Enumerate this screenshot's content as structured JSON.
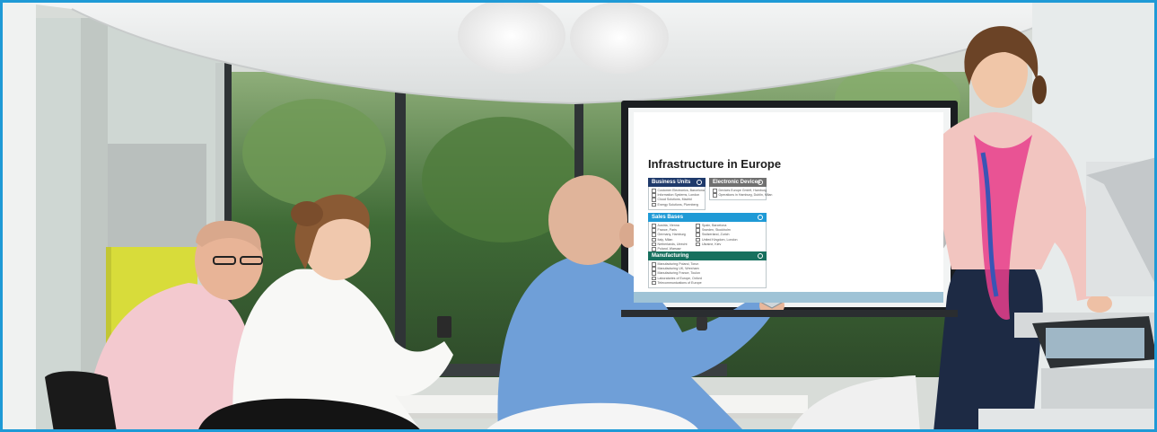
{
  "presentation": {
    "title": "Infrastructure in Europe",
    "sections": [
      {
        "heading": "Business Units",
        "color": "#1f3a6b",
        "items": [
          "Customer Electronics, Barcelona",
          "Information Systems, London",
          "Cloud Solutions, Madrid",
          "Energy Solutions, Plzenberg"
        ]
      },
      {
        "heading": "Electronic Devices",
        "color": "#707070",
        "items": [
          "Devices Europe GmbH, Hamburg",
          "Operations in Hamburg, Dublin, Milan"
        ]
      },
      {
        "heading": "Sales Bases",
        "color": "#1f9ad6",
        "items_left": [
          "Austria, Vienna",
          "France, Paris",
          "Germany, Hamburg",
          "Italy, Milan",
          "Netherlands, Utrecht",
          "Poland, Warsaw"
        ],
        "items_right": [
          "Spain, Barcelona",
          "Sweden, Stockholm",
          "Switzerland, Zurich",
          "United Kingdom, London",
          "Ukraine, Kiev"
        ]
      },
      {
        "heading": "Manufacturing",
        "color": "#17705e",
        "items": [
          "Manufacturing Poland, Torun",
          "Manufacturing UK, Wrexham",
          "Manufacturing France, Toulon",
          "Laboratories of Europe, Oxford",
          "Telecommunications of Europe"
        ]
      }
    ]
  },
  "colors": {
    "frame_border": "#1f9ad6",
    "ceiling": "#eceeee",
    "map_land": "#b9b9b9",
    "map_pins": "#2c7fb8"
  }
}
